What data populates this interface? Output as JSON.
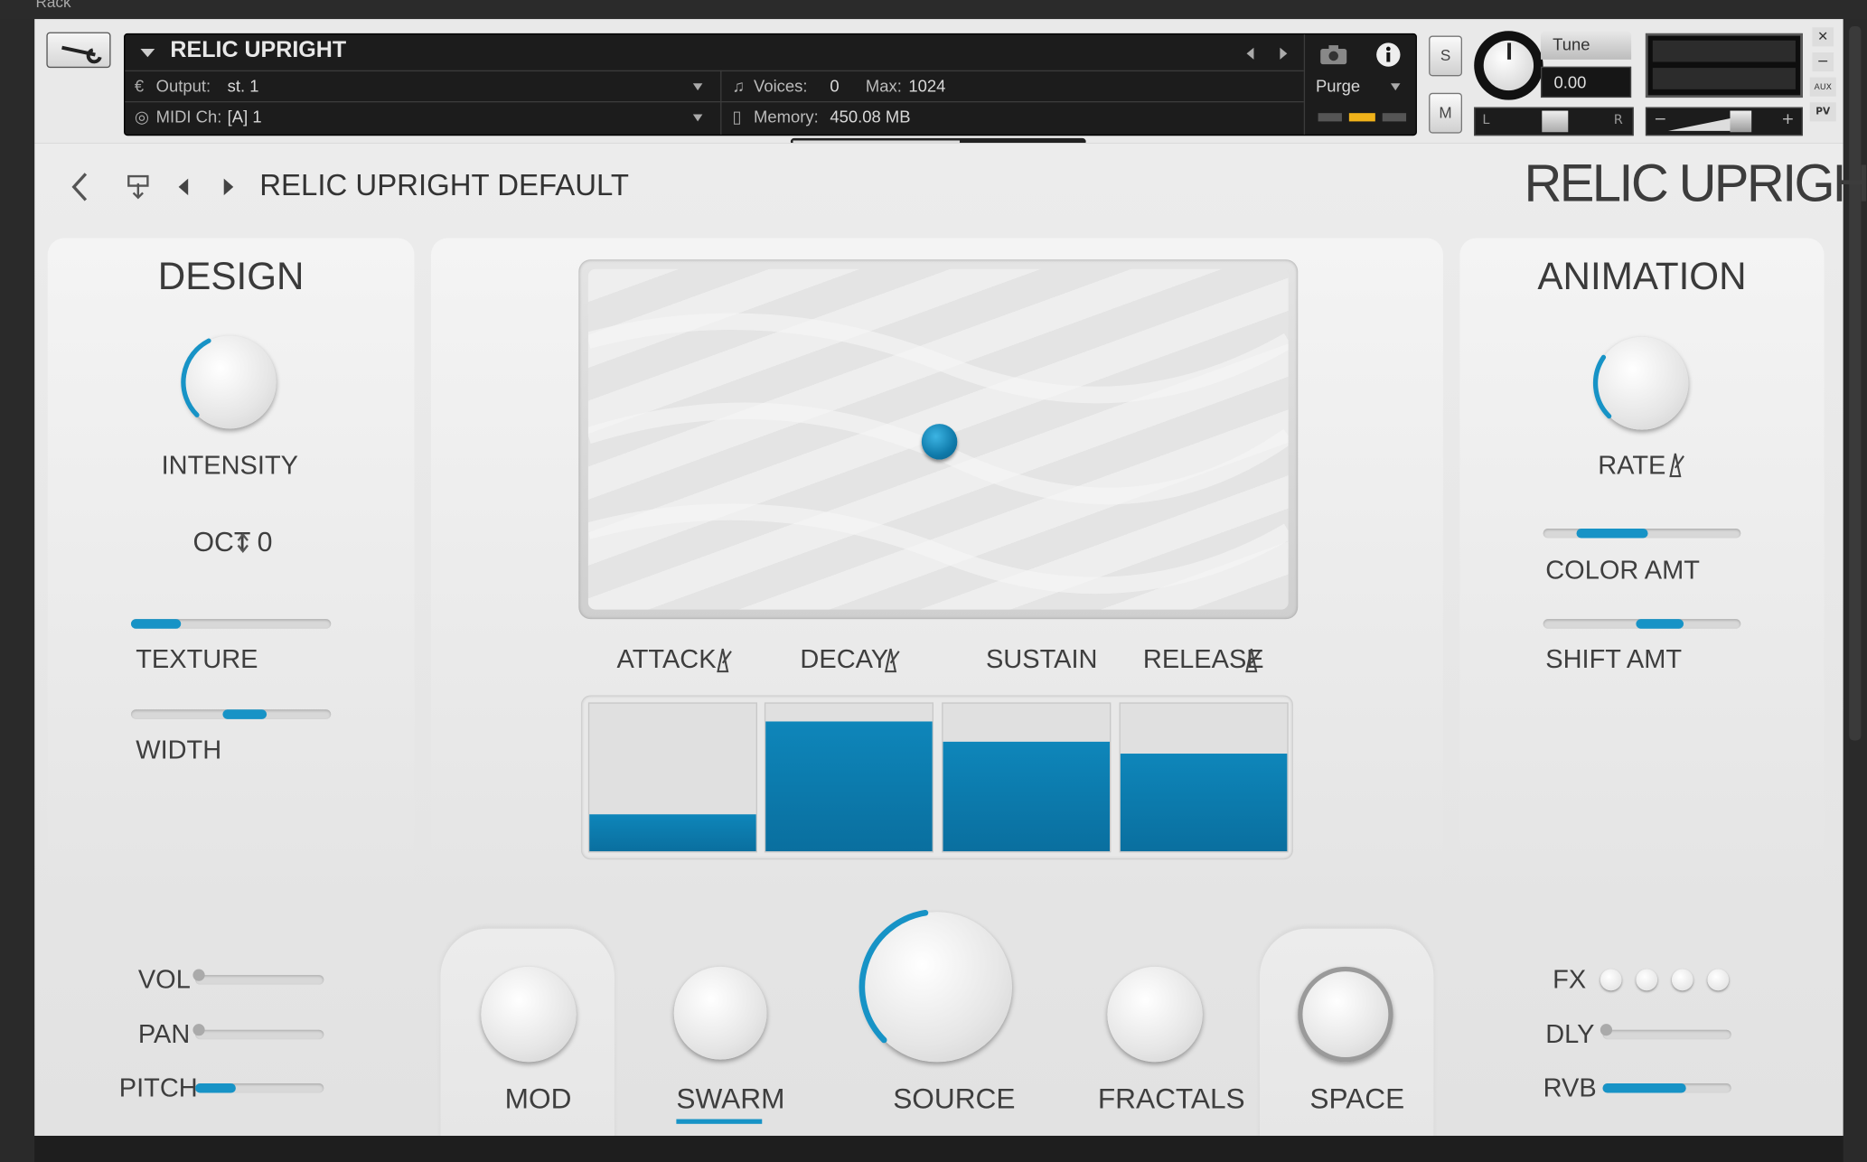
{
  "host": {
    "rack_label": "Rack",
    "instrument_name": "RELIC UPRIGHT",
    "output_label": "Output:",
    "output_value": "st. 1",
    "midi_label": "MIDI Ch:",
    "midi_value": "[A]  1",
    "voices_label": "Voices:",
    "voices_value": "0",
    "max_label": "Max:",
    "max_value": "1024",
    "memory_label": "Memory:",
    "memory_value": "450.08 MB",
    "purge_label": "Purge",
    "solo_label": "S",
    "mute_label": "M",
    "tune_label": "Tune",
    "tune_value": "0.00",
    "pan_left": "L",
    "pan_right": "R",
    "vol_minus": "−",
    "vol_plus": "+",
    "close_label": "✕",
    "min_label": "−",
    "aux_label": "AUX",
    "pv_label": "PV"
  },
  "preset": {
    "name": "RELIC UPRIGHT DEFAULT",
    "logo": "RELIC UPRIGHT"
  },
  "design": {
    "title": "DESIGN",
    "intensity_label": "INTENSITY",
    "oct_label": "OCT",
    "oct_value": "0",
    "texture_label": "TEXTURE",
    "width_label": "WIDTH",
    "intensity_level": 0.3,
    "texture_level": 0.25,
    "width_level": 0.58
  },
  "envelope": {
    "attack_label": "ATTACK",
    "decay_label": "DECAY",
    "sustain_label": "SUSTAIN",
    "release_label": "RELEASE",
    "attack_level": 0.25,
    "decay_level": 0.88,
    "sustain_level": 0.74,
    "release_level": 0.66
  },
  "animation": {
    "title": "ANIMATION",
    "rate_label": "RATE",
    "color_amt_label": "COLOR AMT",
    "shift_amt_label": "SHIFT AMT",
    "rate_level": 0.22
  },
  "bottom": {
    "vol_label": "VOL",
    "pan_label": "PAN",
    "pitch_label": "PITCH",
    "mod_label": "MOD",
    "swarm_label": "SWARM",
    "source_label": "SOURCE",
    "fractals_label": "FRACTALS",
    "space_label": "SPACE",
    "fx_label": "FX",
    "dly_label": "DLY",
    "rvb_label": "RVB",
    "source_level": 0.35
  },
  "colors": {
    "accent": "#1793c6",
    "panel": "#e9e9e9",
    "host_dark": "#1c1c1c"
  }
}
